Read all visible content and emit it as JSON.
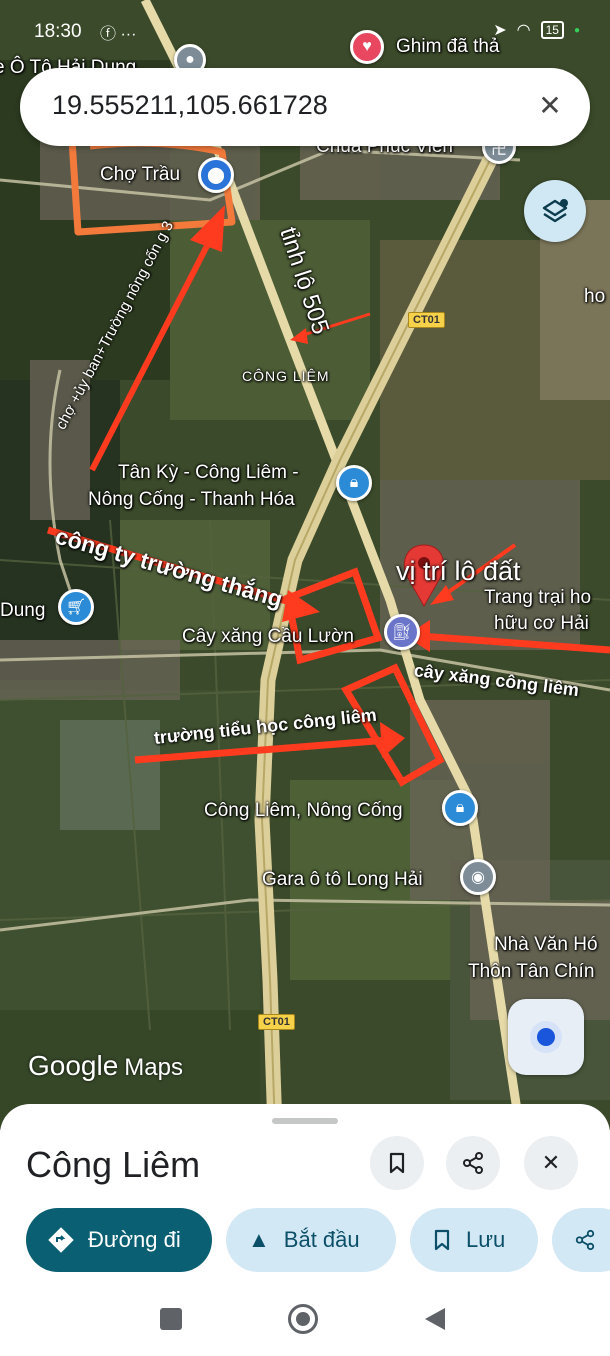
{
  "status_bar": {
    "time": "18:30",
    "left_icons": "ⓕ ···",
    "battery": "15"
  },
  "search": {
    "value": "19.555211,105.661728"
  },
  "map": {
    "top_left_label": "e Ô Tô Hải Dung",
    "top_right_label": "Ghim đã thả",
    "labels": {
      "cho_trau": "Chợ Trầu",
      "chua": "Chùa Phúc Viên",
      "tinh_lo": "tỉnh lộ 505",
      "ho_partial": "ho",
      "cong_liem_area": "CÔNG LIÊM",
      "tan_ky_1": "Tân Kỳ - Công Liêm -",
      "tan_ky_2": "Nông Cống - Thanh Hóa",
      "dung": "Dung",
      "cay_xang": "Cây xăng Cầu Lườn",
      "trang_trai_1": "Trang trại ho",
      "trang_trai_2": "hữu cơ Hải",
      "cong_liem_nong_cong": "Công Liêm, Nông Cống",
      "gara": "Gara ô tô Long Hải",
      "nha_van_hoa_1": "Nhà Văn Hó",
      "nha_van_hoa_2": "Thôn Tân Chín"
    },
    "road_shields": [
      "CT01",
      "CT01"
    ],
    "annotations": {
      "cho_uy_ban": "chợ +ủy ban+Trường nông cốn g 3",
      "cong_ty": "công ty trường thắng",
      "vi_tri": "vị trí lô đất",
      "cay_xang_cong_liem": "cây xăng công liêm",
      "truong_tieu_hoc": "trường tiểu học công liêm"
    },
    "attribution_google": "Google",
    "attribution_maps": "Maps",
    "annotation_color": "#ff3b1f",
    "highlight_color": "#f47a3c"
  },
  "sheet": {
    "title": "Công Liêm",
    "actions": [
      {
        "label": "Đường đi",
        "icon": "directions-icon"
      },
      {
        "label": "Bắt đầu",
        "icon": "navigation-arrow-icon"
      },
      {
        "label": "Lưu",
        "icon": "bookmark-icon"
      },
      {
        "label": "",
        "icon": "share-icon"
      }
    ]
  }
}
